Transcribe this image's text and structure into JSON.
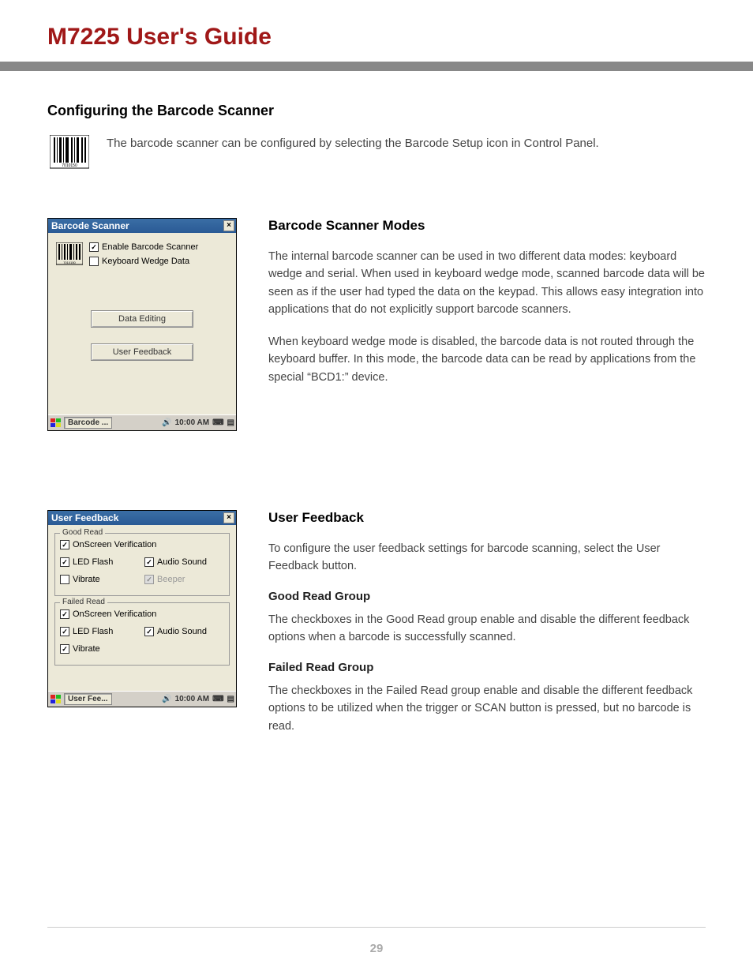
{
  "header": {
    "title": "M7225 User's Guide"
  },
  "section": {
    "heading": "Configuring the Barcode Scanner",
    "intro": "The barcode scanner can be configured by selecting the Barcode Setup icon in Control Panel."
  },
  "window1": {
    "title": "Barcode Scanner",
    "enable_label": "Enable Barcode Scanner",
    "wedge_label": "Keyboard Wedge Data",
    "btn_data_editing": "Data Editing",
    "btn_user_feedback": "User Feedback",
    "taskbar": {
      "task": "Barcode ...",
      "time": "10:00 AM"
    }
  },
  "modes": {
    "heading": "Barcode Scanner Modes",
    "p1": "The internal barcode scanner can be used in two different data modes: keyboard wedge and serial.  When used in keyboard wedge mode, scanned barcode data will be seen as if the user had typed the data on the keypad.  This allows easy integration into applications that do not explicitly support barcode scanners.",
    "p2": "When keyboard wedge mode is disabled, the barcode data is not routed through the keyboard buffer.  In this mode, the barcode data can be read by applications from the special “BCD1:” device."
  },
  "window2": {
    "title": "User Feedback",
    "good_read": {
      "legend": "Good Read",
      "onscreen": "OnScreen Verification",
      "led": "LED Flash",
      "audio": "Audio Sound",
      "vibrate": "Vibrate",
      "beeper": "Beeper"
    },
    "failed_read": {
      "legend": "Failed Read",
      "onscreen": "OnScreen Verification",
      "led": "LED Flash",
      "audio": "Audio Sound",
      "vibrate": "Vibrate"
    },
    "taskbar": {
      "task": "User Fee...",
      "time": "10:00 AM"
    }
  },
  "feedback": {
    "heading": "User Feedback",
    "p1": "To configure the user feedback settings for barcode scanning, select the User Feedback button.",
    "good_heading": "Good Read Group",
    "good_p": "The checkboxes in the Good Read group enable and disable the different feedback options when a barcode is successfully scanned.",
    "failed_heading": "Failed Read Group",
    "failed_p": "The checkboxes in the Failed Read group enable and disable the different feedback options to be utilized when the trigger or SCAN button is pressed, but no barcode is read."
  },
  "page_number": "29"
}
